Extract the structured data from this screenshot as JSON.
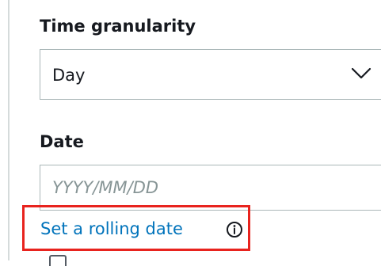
{
  "time_granularity": {
    "label": "Time granularity",
    "selected_value": "Day"
  },
  "date": {
    "label": "Date",
    "placeholder": "YYYY/MM/DD",
    "value": ""
  },
  "rolling_date": {
    "link_label": "Set a rolling date",
    "icon": "info-icon"
  },
  "colors": {
    "link": "#0073bb",
    "highlight_border": "#e8231e",
    "input_border": "#aab7b8",
    "placeholder": "#879596"
  },
  "icons": {
    "select_caret": "chevron-down-icon",
    "info": "info-icon",
    "checkbox": "checkbox-icon"
  }
}
